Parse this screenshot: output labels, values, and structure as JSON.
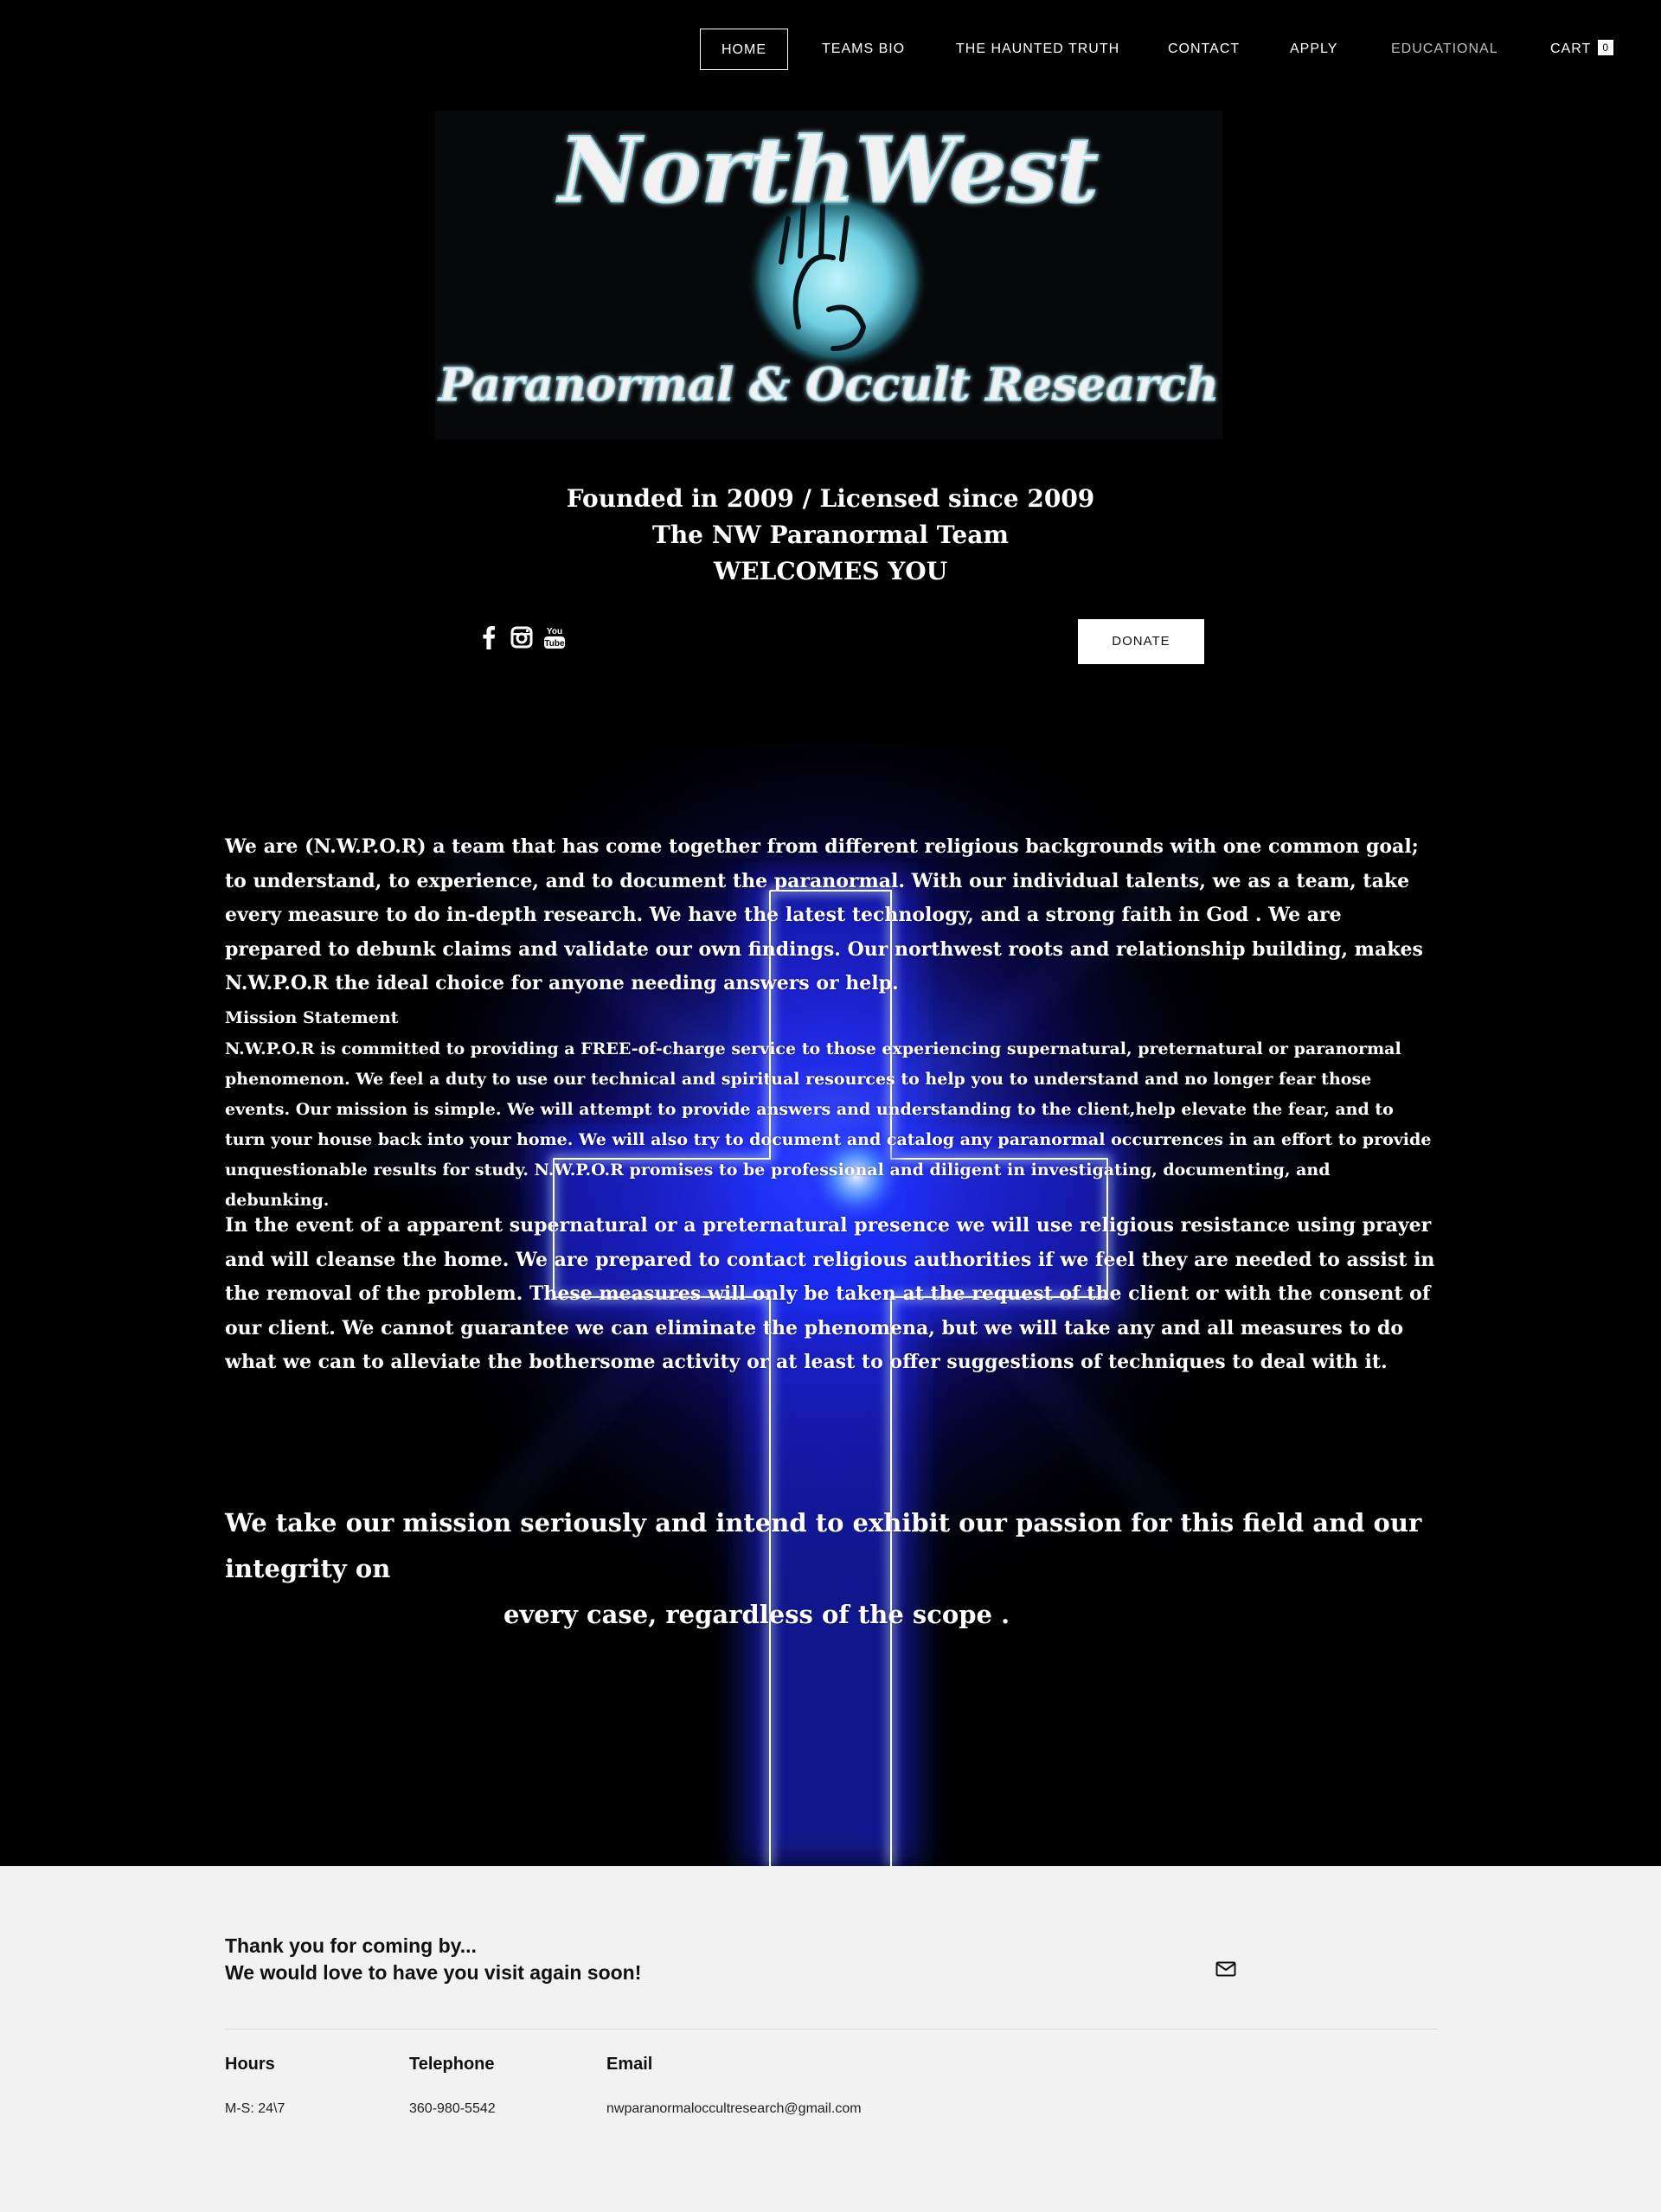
{
  "nav": {
    "items": [
      {
        "label": "HOME"
      },
      {
        "label": "TEAMS BIO"
      },
      {
        "label": "THE HAUNTED TRUTH"
      },
      {
        "label": "CONTACT"
      },
      {
        "label": "APPLY"
      },
      {
        "label": "EDUCATIONAL"
      }
    ],
    "cart_label": "CART",
    "cart_count": "0"
  },
  "logo": {
    "line1": "NorthWest",
    "line2": "Paranormal & Occult Research"
  },
  "hero": {
    "line1": "Founded in 2009 /  Licensed since 2009",
    "line2": "The NW Paranormal Team",
    "line3": "WELCOMES YOU"
  },
  "social": {
    "icons": [
      "facebook-icon",
      "instagram-icon",
      "youtube-icon"
    ]
  },
  "donate_label": "DONATE",
  "content": {
    "para1": "We are (N.W.P.O.R) a team that has come together from different religious backgrounds with one common goal; to understand, to experience, and to document the paranormal. With our individual talents, we as a team, take every measure to do in-depth research. We have the latest technology, and  a strong faith in God . We are prepared to debunk claims and validate our own findings. Our northwest roots and relationship building, makes N.W.P.O.R the ideal choice for anyone needing answers or help.",
    "mission_title": "Mission Statement",
    "mission_body": "N.W.P.O.R is committed to providing a FREE-of-charge service to those experiencing supernatural, preternatural or paranormal phenomenon. We feel a duty to use our technical and spiritual resources to help you to understand and no longer fear those events. Our mission is simple. We will attempt to provide answers and understanding to the client,help elevate the fear, and to turn your house back into your home. We will also try to document and catalog any paranormal occurrences in an effort to provide unquestionable results for study. N.W.P.O.R promises to be professional and diligent in investigating, documenting, and debunking.",
    "para3": " In the event of  a apparent supernatural or a preternatural presence we will use religious resistance using prayer and will cleanse the home. We are prepared to contact religious authorities if we feel they are needed to assist in the removal of the problem. These measures will only be taken at the request of the client or with the consent of our client. We cannot guarantee we can eliminate the phenomena, but we will take any and all measures to do what we can to alleviate the bothersome activity or at least to offer suggestions of techniques to deal with it.",
    "closing_line1": "We take our mission seriously and intend to exhibit our passion for this field and our integrity on",
    "closing_line2": "every case, regardless of the scope ."
  },
  "footer": {
    "thanks_line1": "Thank you for coming by...",
    "thanks_line2": "We would love to have you visit again soon!",
    "hours_label": "Hours",
    "hours_value": "M-S: 24\\7",
    "telephone_label": "Telephone",
    "telephone_value": "360-980-5542",
    "email_label": "Email",
    "email_value": "nwparanormaloccultresearch@gmail.com"
  },
  "colors": {
    "background": "#000000",
    "cross_glow": "#2a2aff",
    "logo_accent": "#7fd8e6",
    "footer_bg": "#f2f2f2"
  }
}
